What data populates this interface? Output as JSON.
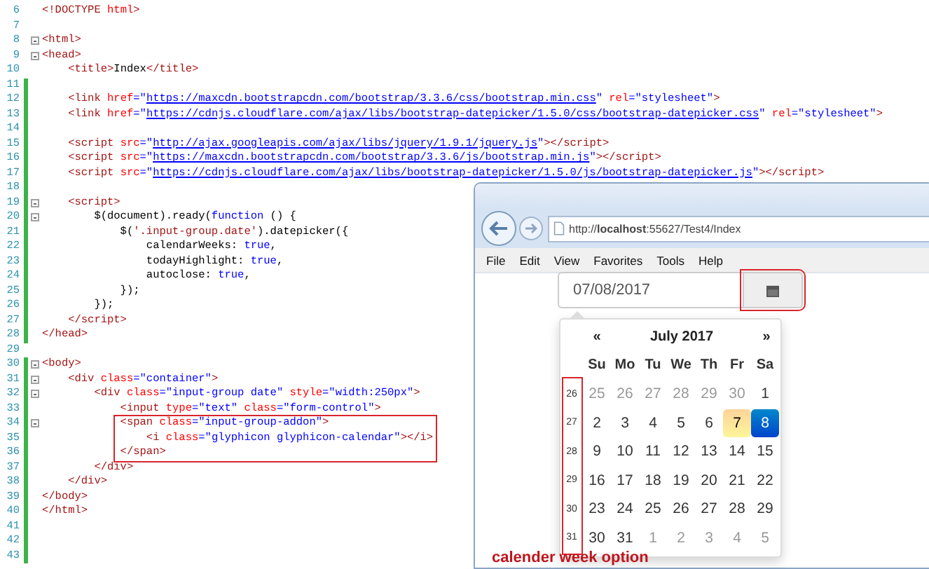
{
  "editor": {
    "lines": [
      {
        "number": "6",
        "changed": false,
        "fold": false,
        "boxed": false,
        "tokens": [
          {
            "text": "<!DOCTYPE ",
            "kind": "tag"
          },
          {
            "text": "html",
            "kind": "attr"
          },
          {
            "text": ">",
            "kind": "tag"
          }
        ]
      },
      {
        "number": "7",
        "changed": false,
        "fold": false,
        "boxed": false
      },
      {
        "number": "8",
        "changed": false,
        "fold": true,
        "boxed": false,
        "tokens": [
          {
            "text": "<html>",
            "kind": "tag"
          }
        ]
      },
      {
        "number": "9",
        "changed": false,
        "fold": true,
        "boxed": false,
        "tokens": [
          {
            "text": "<head>",
            "kind": "tag"
          }
        ]
      },
      {
        "number": "10",
        "changed": false,
        "fold": false,
        "boxed": false,
        "tokens": [
          {
            "text": "    <title>",
            "kind": "tag"
          },
          {
            "text": "Index",
            "kind": "plain"
          },
          {
            "text": "</title>",
            "kind": "tag"
          }
        ]
      },
      {
        "number": "11",
        "changed": true,
        "fold": false,
        "boxed": false
      },
      {
        "number": "12",
        "changed": true,
        "fold": false,
        "boxed": false,
        "tokens": [
          {
            "text": "    <link ",
            "kind": "tag"
          },
          {
            "text": "href",
            "kind": "attr"
          },
          {
            "text": "=\"",
            "kind": "string"
          },
          {
            "text": "https://maxcdn.bootstrapcdn.com/bootstrap/3.3.6/css/bootstrap.min.css",
            "kind": "url"
          },
          {
            "text": "\" ",
            "kind": "string"
          },
          {
            "text": "rel",
            "kind": "attr"
          },
          {
            "text": "=\"stylesheet\"",
            "kind": "string"
          },
          {
            "text": ">",
            "kind": "tag"
          }
        ]
      },
      {
        "number": "13",
        "changed": true,
        "fold": false,
        "boxed": false,
        "tokens": [
          {
            "text": "    <link ",
            "kind": "tag"
          },
          {
            "text": "href",
            "kind": "attr"
          },
          {
            "text": "=\"",
            "kind": "string"
          },
          {
            "text": "https://cdnjs.cloudflare.com/ajax/libs/bootstrap-datepicker/1.5.0/css/bootstrap-datepicker.css",
            "kind": "url"
          },
          {
            "text": "\" ",
            "kind": "string"
          },
          {
            "text": "rel",
            "kind": "attr"
          },
          {
            "text": "=\"stylesheet\"",
            "kind": "string"
          },
          {
            "text": ">",
            "kind": "tag"
          }
        ]
      },
      {
        "number": "14",
        "changed": true,
        "fold": false,
        "boxed": false
      },
      {
        "number": "15",
        "changed": true,
        "fold": false,
        "boxed": false,
        "tokens": [
          {
            "text": "    <script ",
            "kind": "tag"
          },
          {
            "text": "src",
            "kind": "attr"
          },
          {
            "text": "=\"",
            "kind": "string"
          },
          {
            "text": "http://ajax.googleapis.com/ajax/libs/jquery/1.9.1/jquery.js",
            "kind": "url"
          },
          {
            "text": "\"",
            "kind": "string"
          },
          {
            "text": "></script>",
            "kind": "tag"
          }
        ]
      },
      {
        "number": "16",
        "changed": true,
        "fold": false,
        "boxed": false,
        "tokens": [
          {
            "text": "    <script ",
            "kind": "tag"
          },
          {
            "text": "src",
            "kind": "attr"
          },
          {
            "text": "=\"",
            "kind": "string"
          },
          {
            "text": "https://maxcdn.bootstrapcdn.com/bootstrap/3.3.6/js/bootstrap.min.js",
            "kind": "url"
          },
          {
            "text": "\"",
            "kind": "string"
          },
          {
            "text": "></script>",
            "kind": "tag"
          }
        ]
      },
      {
        "number": "17",
        "changed": true,
        "fold": false,
        "boxed": false,
        "tokens": [
          {
            "text": "    <script ",
            "kind": "tag"
          },
          {
            "text": "src",
            "kind": "attr"
          },
          {
            "text": "=\"",
            "kind": "string"
          },
          {
            "text": "https://cdnjs.cloudflare.com/ajax/libs/bootstrap-datepicker/1.5.0/js/bootstrap-datepicker.js",
            "kind": "url"
          },
          {
            "text": "\"",
            "kind": "string"
          },
          {
            "text": "></script>",
            "kind": "tag"
          }
        ]
      },
      {
        "number": "18",
        "changed": true,
        "fold": false,
        "boxed": false
      },
      {
        "number": "19",
        "changed": true,
        "fold": true,
        "boxed": false,
        "tokens": [
          {
            "text": "    <script>",
            "kind": "tag"
          }
        ]
      },
      {
        "number": "20",
        "changed": true,
        "fold": true,
        "boxed": false,
        "tokens": [
          {
            "text": "        $(document).ready(",
            "kind": "plain"
          },
          {
            "text": "function",
            "kind": "keyword"
          },
          {
            "text": " () {",
            "kind": "plain"
          }
        ]
      },
      {
        "number": "21",
        "changed": true,
        "fold": false,
        "boxed": false,
        "tokens": [
          {
            "text": "            $(",
            "kind": "plain"
          },
          {
            "text": "'.input-group.date'",
            "kind": "tag"
          },
          {
            "text": ").datepicker({",
            "kind": "plain"
          }
        ]
      },
      {
        "number": "22",
        "changed": true,
        "fold": false,
        "boxed": false,
        "tokens": [
          {
            "text": "                calendarWeeks: ",
            "kind": "plain"
          },
          {
            "text": "true",
            "kind": "keyword"
          },
          {
            "text": ",",
            "kind": "plain"
          }
        ]
      },
      {
        "number": "23",
        "changed": true,
        "fold": false,
        "boxed": false,
        "tokens": [
          {
            "text": "                todayHighlight: ",
            "kind": "plain"
          },
          {
            "text": "true",
            "kind": "keyword"
          },
          {
            "text": ",",
            "kind": "plain"
          }
        ]
      },
      {
        "number": "24",
        "changed": true,
        "fold": false,
        "boxed": false,
        "tokens": [
          {
            "text": "                autoclose: ",
            "kind": "plain"
          },
          {
            "text": "true",
            "kind": "keyword"
          },
          {
            "text": ",",
            "kind": "plain"
          }
        ]
      },
      {
        "number": "25",
        "changed": true,
        "fold": false,
        "boxed": false,
        "tokens": [
          {
            "text": "            });",
            "kind": "plain"
          }
        ]
      },
      {
        "number": "26",
        "changed": true,
        "fold": false,
        "boxed": false,
        "tokens": [
          {
            "text": "        });",
            "kind": "plain"
          }
        ]
      },
      {
        "number": "27",
        "changed": true,
        "fold": false,
        "boxed": false,
        "tokens": [
          {
            "text": "    </script>",
            "kind": "tag"
          }
        ]
      },
      {
        "number": "28",
        "changed": true,
        "fold": false,
        "boxed": false,
        "tokens": [
          {
            "text": "</head>",
            "kind": "tag"
          }
        ]
      },
      {
        "number": "29",
        "changed": false,
        "fold": false,
        "boxed": false
      },
      {
        "number": "30",
        "changed": true,
        "fold": true,
        "boxed": false,
        "tokens": [
          {
            "text": "<body>",
            "kind": "tag"
          }
        ]
      },
      {
        "number": "31",
        "changed": true,
        "fold": true,
        "boxed": false,
        "tokens": [
          {
            "text": "    <div ",
            "kind": "tag"
          },
          {
            "text": "class",
            "kind": "attr"
          },
          {
            "text": "=\"container\"",
            "kind": "string"
          },
          {
            "text": ">",
            "kind": "tag"
          }
        ]
      },
      {
        "number": "32",
        "changed": true,
        "fold": true,
        "boxed": false,
        "tokens": [
          {
            "text": "        <div ",
            "kind": "tag"
          },
          {
            "text": "class",
            "kind": "attr"
          },
          {
            "text": "=\"input-group date\" ",
            "kind": "string"
          },
          {
            "text": "style",
            "kind": "attr"
          },
          {
            "text": "=\"width:250px\"",
            "kind": "string"
          },
          {
            "text": ">",
            "kind": "tag"
          }
        ]
      },
      {
        "number": "33",
        "changed": true,
        "fold": false,
        "boxed": false,
        "tokens": [
          {
            "text": "            <input ",
            "kind": "tag"
          },
          {
            "text": "type",
            "kind": "attr"
          },
          {
            "text": "=\"text\" ",
            "kind": "string"
          },
          {
            "text": "class",
            "kind": "attr"
          },
          {
            "text": "=\"form-control\"",
            "kind": "string"
          },
          {
            "text": ">",
            "kind": "tag"
          }
        ]
      },
      {
        "number": "34",
        "changed": true,
        "fold": true,
        "boxed": true,
        "tokens": [
          {
            "text": "            <span ",
            "kind": "tag"
          },
          {
            "text": "class",
            "kind": "attr"
          },
          {
            "text": "=\"input-group-addon\"",
            "kind": "string"
          },
          {
            "text": ">",
            "kind": "tag"
          }
        ]
      },
      {
        "number": "35",
        "changed": true,
        "fold": false,
        "boxed": true,
        "tokens": [
          {
            "text": "                <i ",
            "kind": "tag"
          },
          {
            "text": "class",
            "kind": "attr"
          },
          {
            "text": "=\"glyphicon glyphicon-calendar\"",
            "kind": "string"
          },
          {
            "text": "></i>",
            "kind": "tag"
          }
        ]
      },
      {
        "number": "36",
        "changed": true,
        "fold": false,
        "boxed": true,
        "tokens": [
          {
            "text": "            </span>",
            "kind": "tag"
          }
        ]
      },
      {
        "number": "37",
        "changed": true,
        "fold": false,
        "boxed": false,
        "tokens": [
          {
            "text": "        </div>",
            "kind": "tag"
          }
        ]
      },
      {
        "number": "38",
        "changed": true,
        "fold": false,
        "boxed": false,
        "tokens": [
          {
            "text": "    </div>",
            "kind": "tag"
          }
        ]
      },
      {
        "number": "39",
        "changed": true,
        "fold": false,
        "boxed": false,
        "tokens": [
          {
            "text": "</body>",
            "kind": "tag"
          }
        ]
      },
      {
        "number": "40",
        "changed": true,
        "fold": false,
        "boxed": false,
        "tokens": [
          {
            "text": "</html>",
            "kind": "tag"
          }
        ]
      },
      {
        "number": "41",
        "changed": true,
        "fold": false,
        "boxed": false
      },
      {
        "number": "42",
        "changed": true,
        "fold": false,
        "boxed": false
      },
      {
        "number": "43",
        "changed": true,
        "fold": false,
        "boxed": false
      }
    ]
  },
  "browser": {
    "address": "http://**localhost**:55627/Test4/Index",
    "menu": [
      "File",
      "Edit",
      "View",
      "Favorites",
      "Tools",
      "Help"
    ],
    "date_input": {
      "value": "07/08/2017"
    },
    "calendar_button": {
      "highlighted": true
    },
    "calendar": {
      "prev": "«",
      "title": "July 2017",
      "next": "»",
      "weekdays": [
        "Su",
        "Mo",
        "Tu",
        "We",
        "Th",
        "Fr",
        "Sa"
      ],
      "weeks_highlighted": true,
      "weeks": [
        {
          "number": "26",
          "days": [
            {
              "day": "25",
              "muted": true,
              "today": false,
              "selected": false
            },
            {
              "day": "26",
              "muted": true,
              "today": false,
              "selected": false
            },
            {
              "day": "27",
              "muted": true,
              "today": false,
              "selected": false
            },
            {
              "day": "28",
              "muted": true,
              "today": false,
              "selected": false
            },
            {
              "day": "29",
              "muted": true,
              "today": false,
              "selected": false
            },
            {
              "day": "30",
              "muted": true,
              "today": false,
              "selected": false
            },
            {
              "day": "1",
              "muted": false,
              "today": false,
              "selected": false
            }
          ]
        },
        {
          "number": "27",
          "days": [
            {
              "day": "2",
              "muted": false,
              "today": false,
              "selected": false
            },
            {
              "day": "3",
              "muted": false,
              "today": false,
              "selected": false
            },
            {
              "day": "4",
              "muted": false,
              "today": false,
              "selected": false
            },
            {
              "day": "5",
              "muted": false,
              "today": false,
              "selected": false
            },
            {
              "day": "6",
              "muted": false,
              "today": false,
              "selected": false
            },
            {
              "day": "7",
              "muted": false,
              "today": true,
              "selected": false
            },
            {
              "day": "8",
              "muted": false,
              "today": false,
              "selected": true
            }
          ]
        },
        {
          "number": "28",
          "days": [
            {
              "day": "9",
              "muted": false,
              "today": false,
              "selected": false
            },
            {
              "day": "10",
              "muted": false,
              "today": false,
              "selected": false
            },
            {
              "day": "11",
              "muted": false,
              "today": false,
              "selected": false
            },
            {
              "day": "12",
              "muted": false,
              "today": false,
              "selected": false
            },
            {
              "day": "13",
              "muted": false,
              "today": false,
              "selected": false
            },
            {
              "day": "14",
              "muted": false,
              "today": false,
              "selected": false
            },
            {
              "day": "15",
              "muted": false,
              "today": false,
              "selected": false
            }
          ]
        },
        {
          "number": "29",
          "days": [
            {
              "day": "16",
              "muted": false,
              "today": false,
              "selected": false
            },
            {
              "day": "17",
              "muted": false,
              "today": false,
              "selected": false
            },
            {
              "day": "18",
              "muted": false,
              "today": false,
              "selected": false
            },
            {
              "day": "19",
              "muted": false,
              "today": false,
              "selected": false
            },
            {
              "day": "20",
              "muted": false,
              "today": false,
              "selected": false
            },
            {
              "day": "21",
              "muted": false,
              "today": false,
              "selected": false
            },
            {
              "day": "22",
              "muted": false,
              "today": false,
              "selected": false
            }
          ]
        },
        {
          "number": "30",
          "days": [
            {
              "day": "23",
              "muted": false,
              "today": false,
              "selected": false
            },
            {
              "day": "24",
              "muted": false,
              "today": false,
              "selected": false
            },
            {
              "day": "25",
              "muted": false,
              "today": false,
              "selected": false
            },
            {
              "day": "26",
              "muted": false,
              "today": false,
              "selected": false
            },
            {
              "day": "27",
              "muted": false,
              "today": false,
              "selected": false
            },
            {
              "day": "28",
              "muted": false,
              "today": false,
              "selected": false
            },
            {
              "day": "29",
              "muted": false,
              "today": false,
              "selected": false
            }
          ]
        },
        {
          "number": "31",
          "days": [
            {
              "day": "30",
              "muted": false,
              "today": false,
              "selected": false
            },
            {
              "day": "31",
              "muted": false,
              "today": false,
              "selected": false
            },
            {
              "day": "1",
              "muted": true,
              "today": false,
              "selected": false
            },
            {
              "day": "2",
              "muted": true,
              "today": false,
              "selected": false
            },
            {
              "day": "3",
              "muted": true,
              "today": false,
              "selected": false
            },
            {
              "day": "4",
              "muted": true,
              "today": false,
              "selected": false
            },
            {
              "day": "5",
              "muted": true,
              "today": false,
              "selected": false
            }
          ]
        }
      ]
    }
  },
  "caption": "calender week option"
}
